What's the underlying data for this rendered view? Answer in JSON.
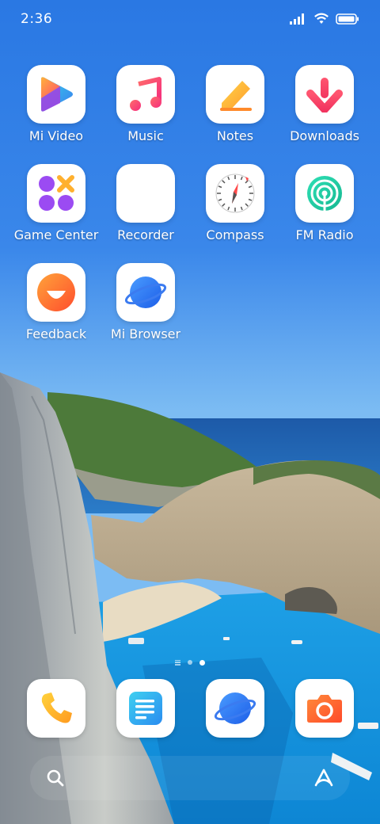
{
  "status_bar": {
    "time": "2:36",
    "icons": [
      "signal-icon",
      "wifi-icon",
      "battery-icon"
    ]
  },
  "apps": [
    {
      "label": "Mi Video",
      "icon": "mi-video-icon"
    },
    {
      "label": "Music",
      "icon": "music-icon"
    },
    {
      "label": "Notes",
      "icon": "notes-icon"
    },
    {
      "label": "Downloads",
      "icon": "downloads-icon"
    },
    {
      "label": "Game Center",
      "icon": "game-center-icon"
    },
    {
      "label": "Recorder",
      "icon": "recorder-icon"
    },
    {
      "label": "Compass",
      "icon": "compass-icon"
    },
    {
      "label": "FM Radio",
      "icon": "fm-radio-icon"
    },
    {
      "label": "Feedback",
      "icon": "feedback-icon"
    },
    {
      "label": "Mi Browser",
      "icon": "mi-browser-icon"
    }
  ],
  "page_indicator": {
    "pages": 2,
    "current": 2
  },
  "dock": [
    {
      "icon": "phone-icon"
    },
    {
      "icon": "messages-icon"
    },
    {
      "icon": "browser-icon"
    },
    {
      "icon": "camera-icon"
    }
  ],
  "search_bar": {
    "left_icon": "search-icon",
    "right_icon": "assistant-icon"
  },
  "colors": {
    "sky": "#2d7ee6",
    "sea": "#1e9be0",
    "label": "#ffffff"
  }
}
